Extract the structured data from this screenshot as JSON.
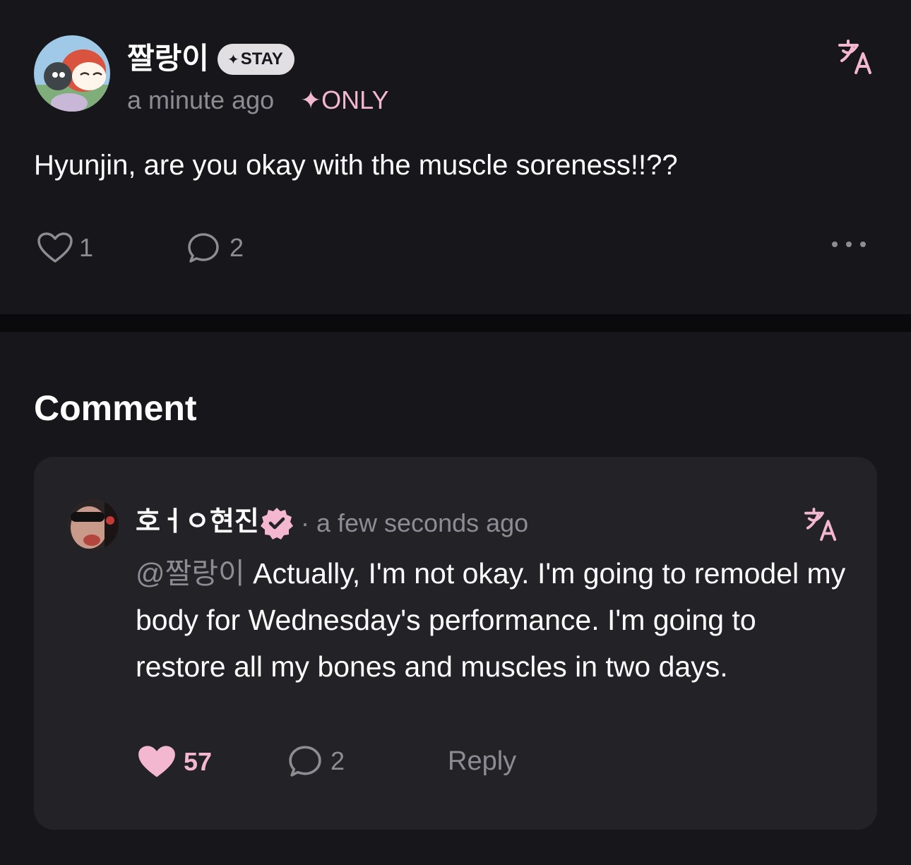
{
  "post": {
    "author": "짤랑이",
    "badge": "STAY",
    "badge_star": "✦",
    "time": "a minute ago",
    "only_star": "✦",
    "only_label": "ONLY",
    "text": "Hyunjin, are you okay with the muscle soreness!!??",
    "likes": "1",
    "comments": "2",
    "icons": {
      "translate": "translate-icon",
      "like": "heart-outline-icon",
      "comment": "speech-bubble-icon",
      "more": "more-dots-icon"
    }
  },
  "comments_section": {
    "title": "Comment",
    "items": [
      {
        "author": "호ㅓㅇ현진",
        "verified_icon": "verified-badge-icon",
        "time": "· a few seconds ago",
        "mention": "@짤랑이",
        "text": " Actually, I'm not okay. I'm going to remodel my body for Wednesday's performance. I'm going to restore all my bones and muscles in two days.",
        "likes": "57",
        "liked": true,
        "replies": "2",
        "reply_label": "Reply"
      }
    ]
  },
  "colors": {
    "background": "#16161b",
    "card": "#222227",
    "accent_pink": "#f3b8cf",
    "muted": "#8c8c92"
  }
}
